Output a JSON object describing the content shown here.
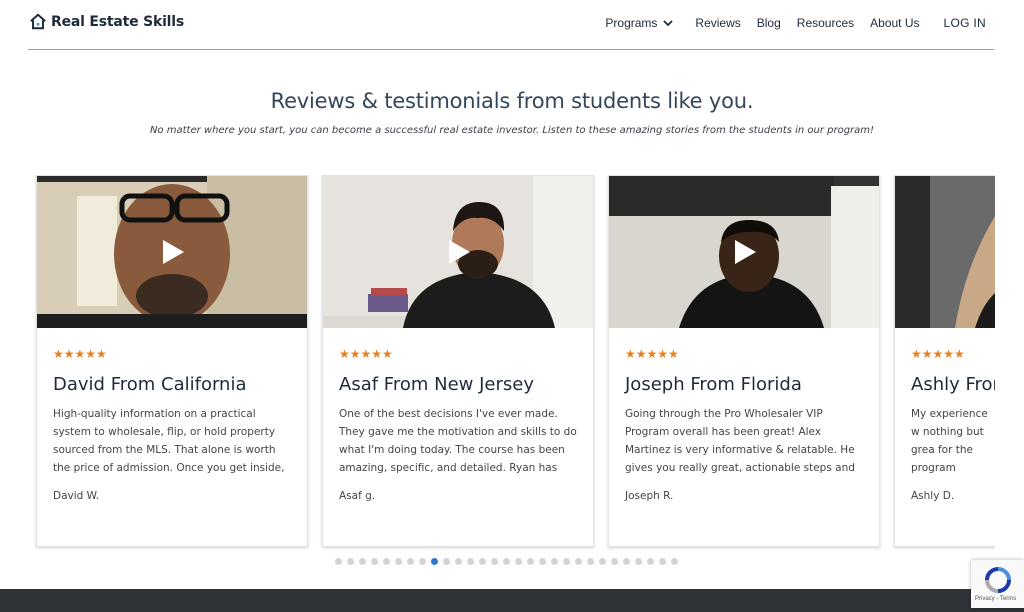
{
  "header": {
    "logo_text": "Real Estate Skills",
    "nav": {
      "programs": "Programs",
      "reviews": "Reviews",
      "blog": "Blog",
      "resources": "Resources",
      "about": "About Us",
      "login": "LOG IN"
    }
  },
  "section": {
    "title": "Reviews & testimonials from students like you.",
    "subtitle": "No matter where you start, you can become a successful real estate investor. Listen to these amazing stories from the students in our program!"
  },
  "cards": [
    {
      "stars": "★★★★★",
      "name": "David From California",
      "review": "High-quality information on a practical system to wholesale, flip, or hold property sourced from the MLS. That alone is worth the price of admission. Once you get inside, you'll find a...",
      "author": "David W."
    },
    {
      "stars": "★★★★★",
      "name": "Asaf From New Jersey",
      "review": "One of the best decisions I've ever made. They gave me the motivation and skills to do what I'm doing today. The course has been amazing, specific, and detailed. Ryan has been extreme...",
      "author": "Asaf g."
    },
    {
      "stars": "★★★★★",
      "name": "Joseph From Florida",
      "review": "Going through the Pro Wholesaler VIP Program overall has been great! Alex Martinez is very informative & relatable. He gives you really great, actionable steps and overall life...",
      "author": "Joseph R."
    },
    {
      "stars": "★★★★★",
      "name": "Ashly From",
      "review": "My experience w nothing but grea for the program resources to be s",
      "author": "Ashly D."
    }
  ],
  "carousel": {
    "dot_count": 29,
    "active_index": 8,
    "active_color": "#2a7bd1"
  },
  "recaptcha": {
    "text": "Privacy - Terms"
  },
  "colors": {
    "star": "#e8801d",
    "footer": "#2f3336"
  }
}
